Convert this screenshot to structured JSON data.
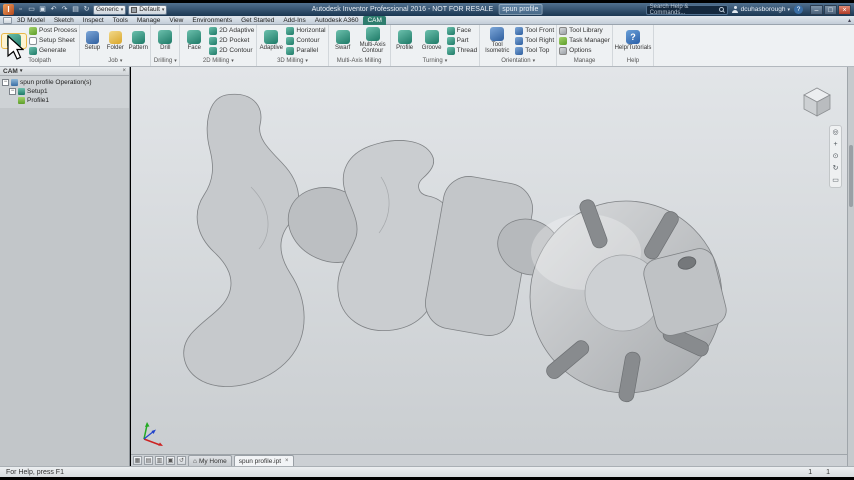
{
  "titlebar": {
    "app_title": "Autodesk Inventor Professional 2016 - NOT FOR RESALE",
    "document": "spun profile",
    "search_placeholder": "Search Help & Commands...",
    "user": "dcuhasborough",
    "material": "Generic",
    "appearance": "Default"
  },
  "icons": {
    "logo": "I",
    "menu_arrow": "▾",
    "collapse": "▴",
    "close": "×",
    "minimize": "–",
    "maximize": "□",
    "home": "⌂",
    "help": "?",
    "expander": "−"
  },
  "qat_glyphs": [
    "▫",
    "▭",
    "▣",
    "↶",
    "↷",
    "▤",
    "↻"
  ],
  "tabs": [
    "3D Model",
    "Sketch",
    "Inspect",
    "Tools",
    "Manage",
    "View",
    "Environments",
    "Get Started",
    "Add-Ins",
    "Autodesk A360",
    "CAM"
  ],
  "ribbon": {
    "groups": [
      {
        "label": "Toolpath",
        "stack": [
          "Post Process",
          "Setup Sheet",
          "Generate"
        ]
      },
      {
        "label": "Job",
        "buttons": [
          "Setup",
          "Folder",
          "Pattern"
        ]
      },
      {
        "label": "Drilling",
        "big": [
          "Drill"
        ]
      },
      {
        "label": "2D Milling",
        "big": [
          "Face"
        ],
        "stack": [
          "2D Adaptive",
          "2D Pocket",
          "2D Contour"
        ]
      },
      {
        "label": "3D Milling",
        "big": [
          "Adaptive"
        ],
        "stack": [
          "Horizontal",
          "Contour",
          "Parallel"
        ]
      },
      {
        "label": "Multi-Axis Milling",
        "big": [
          "Swarf",
          "Multi-Axis Contour"
        ]
      },
      {
        "label": "Turning",
        "big": [
          "Profile",
          "Groove"
        ],
        "stack": [
          "Face",
          "Part",
          "Thread"
        ]
      },
      {
        "label": "Orientation",
        "big": [
          "Tool Isometric"
        ],
        "stack": [
          "Tool Front",
          "Tool Right",
          "Tool Top"
        ]
      },
      {
        "label": "Manage",
        "stack": [
          "Tool Library",
          "Task Manager",
          "Options"
        ]
      },
      {
        "label": "Help",
        "big": [
          "Help/Tutorials"
        ]
      }
    ]
  },
  "browser": {
    "title": "CAM",
    "items": [
      "spun profile Operation(s)",
      "Setup1",
      "Profile1"
    ]
  },
  "navbar_glyphs": [
    "◎",
    "+",
    "⊙",
    "↻",
    "▭"
  ],
  "docbar_glyphs": [
    "▦",
    "▤",
    "▥",
    "▣",
    "↺"
  ],
  "doctabs": {
    "home": "My Home",
    "active": "spun profile.ipt"
  },
  "status": {
    "hint": "For Help, press F1",
    "count1": "1",
    "count2": "1"
  }
}
